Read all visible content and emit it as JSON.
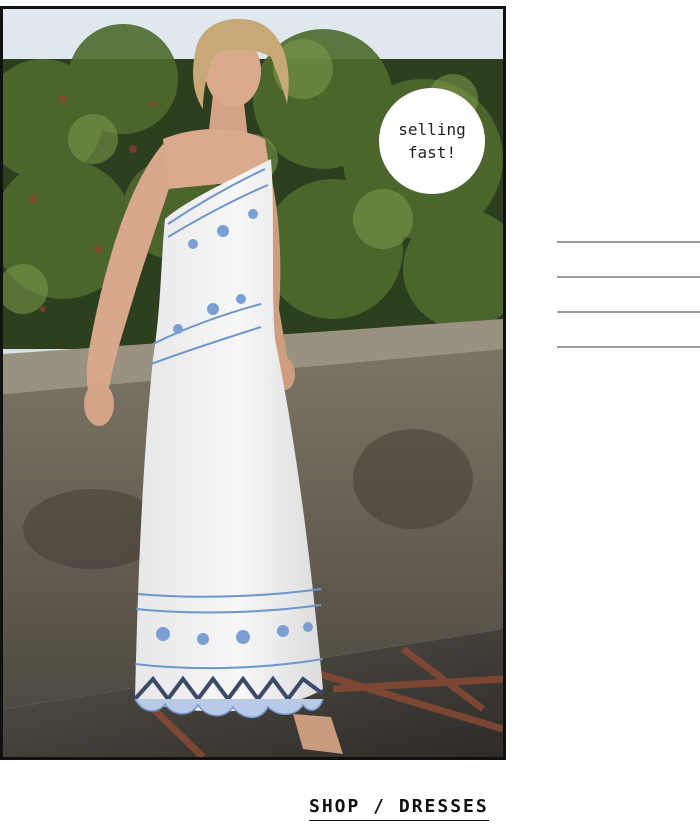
{
  "hero": {
    "image_alt": "Model in white one-shoulder maxi dress with blue embroidery",
    "badge_text_line1": "selling",
    "badge_text_line2": "fast!"
  },
  "side_menu": {
    "icon": "hamburger-lines"
  },
  "breadcrumb_link": {
    "label": "SHOP / DRESSES"
  },
  "colors": {
    "frame": "#111111",
    "dress_embroidery": "#6f95c9",
    "rule": "#9a9a9a"
  }
}
